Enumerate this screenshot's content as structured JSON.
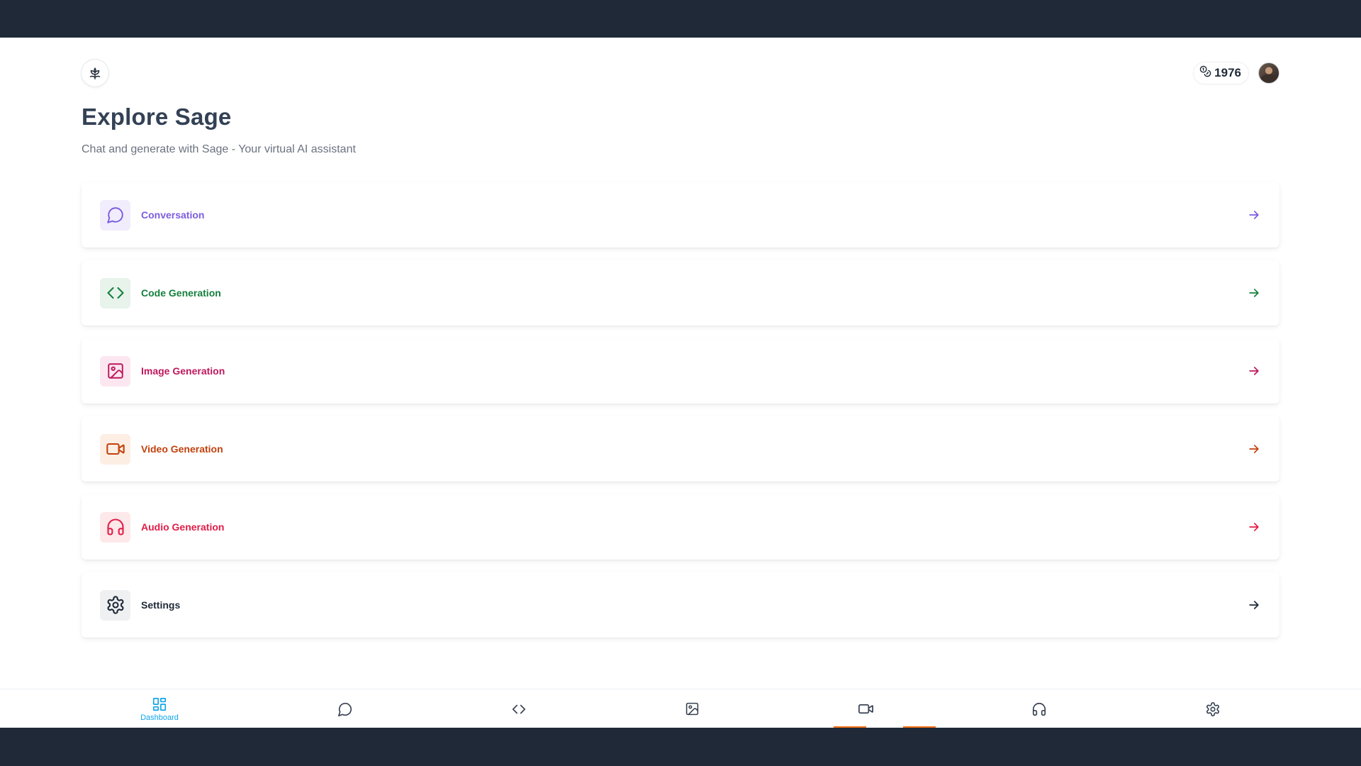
{
  "header": {
    "logo_icon": "leaf-logo-icon",
    "credits_icon": "coins-icon",
    "credits": "1976",
    "avatar": "user-avatar"
  },
  "page": {
    "title": "Explore Sage",
    "subtitle": "Chat and generate with Sage - Your virtual AI assistant"
  },
  "cards": [
    {
      "label": "Conversation",
      "icon": "message-circle-icon",
      "color": "#7c5ce0",
      "bg": "#f1edfc"
    },
    {
      "label": "Code Generation",
      "icon": "code-icon",
      "color": "#15803d",
      "bg": "#e8f3ec"
    },
    {
      "label": "Image Generation",
      "icon": "image-icon",
      "color": "#be185d",
      "bg": "#fce7f0"
    },
    {
      "label": "Video Generation",
      "icon": "video-icon",
      "color": "#c2410c",
      "bg": "#fdeee4"
    },
    {
      "label": "Audio Generation",
      "icon": "headphones-icon",
      "color": "#e11d48",
      "bg": "#fde8ea"
    },
    {
      "label": "Settings",
      "icon": "gear-icon",
      "color": "#1f2937",
      "bg": "#eef0f2"
    }
  ],
  "bottom_nav": [
    {
      "label": "Dashboard",
      "icon": "dashboard-icon",
      "active": true
    },
    {
      "label": "",
      "icon": "message-circle-icon"
    },
    {
      "label": "",
      "icon": "code-icon"
    },
    {
      "label": "",
      "icon": "image-icon"
    },
    {
      "label": "",
      "icon": "video-icon"
    },
    {
      "label": "",
      "icon": "headphones-icon"
    },
    {
      "label": "",
      "icon": "gear-icon"
    }
  ],
  "colors": {
    "frame": "#1f2937",
    "active_nav": "#0ea5e9",
    "title": "#334155",
    "subtitle": "#6b7280"
  }
}
